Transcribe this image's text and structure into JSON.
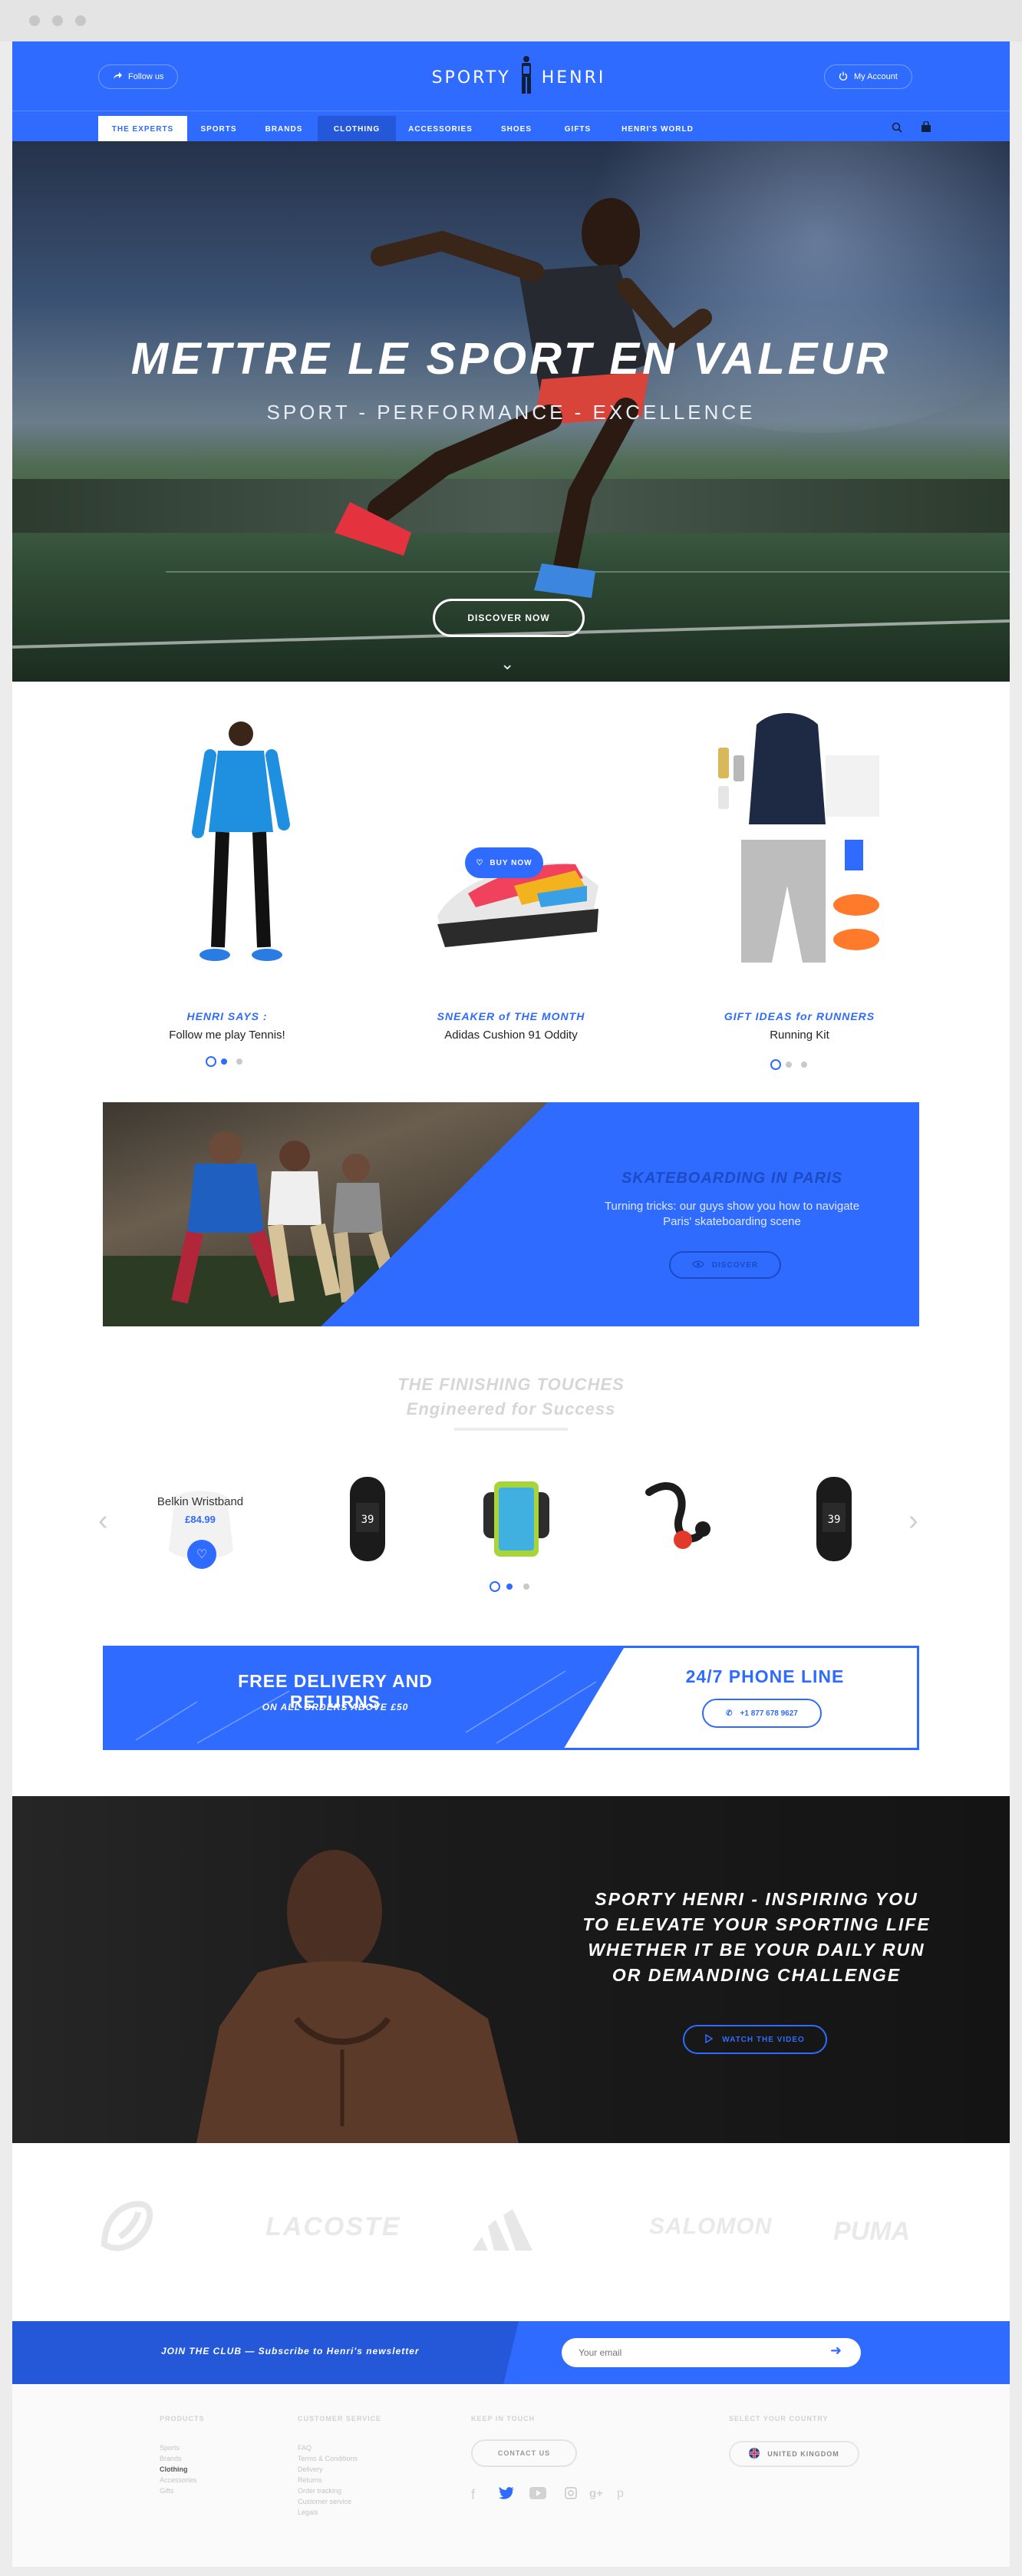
{
  "header": {
    "follow_label": "Follow us",
    "logo_text_left": "SPORTY",
    "logo_text_right": "HENRI",
    "account_label": "My Account"
  },
  "nav": {
    "items": [
      {
        "label": "THE EXPERTS"
      },
      {
        "label": "SPORTS"
      },
      {
        "label": "BRANDS"
      },
      {
        "label": "CLOTHING"
      },
      {
        "label": "ACCESSORIES"
      },
      {
        "label": "SHOES"
      },
      {
        "label": "GIFTS"
      },
      {
        "label": "HENRI'S WORLD"
      }
    ]
  },
  "hero": {
    "title": "METTRE LE SPORT EN VALEUR",
    "subtitle": "SPORT - PERFORMANCE - EXCELLENCE",
    "cta": "DISCOVER NOW"
  },
  "products": [
    {
      "kicker": "HENRI SAYS :",
      "name": "Follow me play Tennis!"
    },
    {
      "kicker": "SNEAKER of THE MONTH",
      "name": "Adidas Cushion 91 Oddity",
      "cta": "BUY NOW"
    },
    {
      "kicker": "GIFT IDEAS for RUNNERS",
      "name": "Running Kit"
    }
  ],
  "skate": {
    "title": "SKATEBOARDING IN PARIS",
    "text": "Turning tricks: our guys show you how to navigate Paris' skateboarding scene",
    "cta": "DISCOVER"
  },
  "finishing": {
    "title_line1": "THE FINISHING TOUCHES",
    "title_line2": "Engineered for Success",
    "featured_name": "Belkin Wristband",
    "featured_price": "£84.99"
  },
  "delivery": {
    "heading": "FREE DELIVERY AND RETURNS",
    "subheading": "ON ALL ORDERS ABOVE £50",
    "phone_heading": "24/7 PHONE LINE",
    "phone_number": "+1 877 678 9627"
  },
  "dark": {
    "text": "SPORTY HENRI - INSPIRING YOU TO ELEVATE YOUR SPORTING LIFE WHETHER IT BE YOUR DAILY RUN OR DEMANDING CHALLENGE",
    "cta": "WATCH THE VIDEO"
  },
  "brands": [
    "asics",
    "LACOSTE",
    "adidas",
    "SALOMON",
    "PUMA"
  ],
  "newsletter": {
    "text": "JOIN THE CLUB — Subscribe to Henri's newsletter",
    "placeholder": "Your email"
  },
  "footer": {
    "products_heading": "PRODUCTS",
    "products_links": [
      "Sports",
      "Brands",
      "Clothing",
      "Accessories",
      "Gifts"
    ],
    "service_heading": "CUSTOMER SERVICE",
    "service_links": [
      "FAQ",
      "Terms & Conditions",
      "Delivery",
      "Returns",
      "Order tracking",
      "Customer service",
      "Legals"
    ],
    "touch_heading": "KEEP IN TOUCH",
    "contact_label": "CONTACT US",
    "country_heading": "SELECT YOUR COUNTRY",
    "country_label": "UNITED KINGDOM"
  },
  "colors": {
    "accent": "#2f6bff",
    "accent_dark": "#2458d9",
    "dark_bg": "#1b1b1b"
  }
}
